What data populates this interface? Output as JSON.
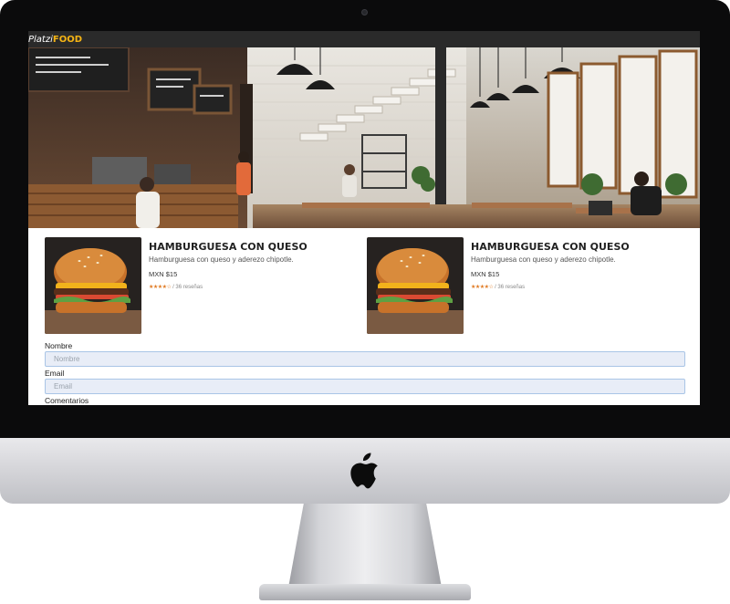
{
  "brand": {
    "prefix": "Platzi",
    "suffix": "FOOD"
  },
  "hero": {
    "alt_icon": "restaurant-interior-photo"
  },
  "cards": [
    {
      "title": "HAMBURGUESA CON QUESO",
      "description": "Hamburguesa con queso y aderezo chipotle.",
      "price": "MXN $15",
      "stars": "★★★★☆",
      "reviews": "/ 36 reseñas",
      "image_icon": "burger-photo"
    },
    {
      "title": "HAMBURGUESA CON QUESO",
      "description": "Hamburguesa con queso y aderezo chipotle.",
      "price": "MXN $15",
      "stars": "★★★★☆",
      "reviews": "/ 36 reseñas",
      "image_icon": "burger-photo"
    }
  ],
  "form": {
    "name_label": "Nombre",
    "name_placeholder": "Nombre",
    "email_label": "Email",
    "email_placeholder": "Email",
    "comments_label": "Comentarios"
  },
  "device": {
    "logo_icon": "apple-logo-icon"
  },
  "colors": {
    "brand_accent": "#f5b414",
    "navbar": "#2a2a2a",
    "input_bg": "#e8edf7",
    "star": "#e07b24"
  }
}
